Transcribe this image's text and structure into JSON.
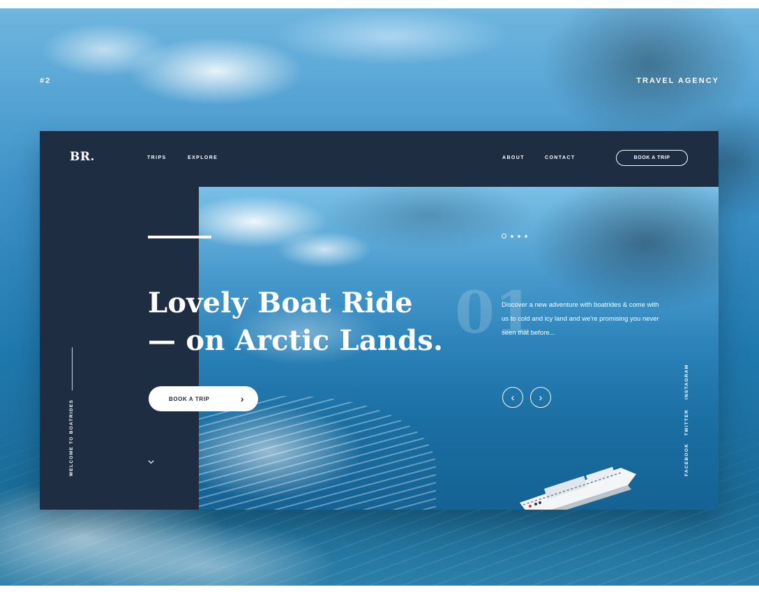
{
  "corner": {
    "left": "#2",
    "right": "TRAVEL AGENCY"
  },
  "nav": {
    "logo": "BR.",
    "links": [
      "TRIPS",
      "EXPLORE",
      "ABOUT",
      "CONTACT"
    ],
    "cta": "BOOK A TRIP"
  },
  "hero": {
    "headline_line1": "Lovely Boat Ride",
    "headline_line2": "— on Arctic Lands.",
    "cta": "BOOK A TRIP",
    "slide_number": "01",
    "description": "Discover a new adventure with boatrides & come with us to cold and icy land and we're promising you never seen that before...",
    "slides_total": 4,
    "active_slide": 1
  },
  "side_label": "WELCOME TO BOATRIDES",
  "social": [
    "FACEBOOK",
    "TWITTER",
    "INSTAGRAM"
  ],
  "icons": {
    "prev": "chevron-left-icon",
    "next": "chevron-right-icon",
    "cta_arrow": "chevron-right-icon",
    "scroll": "chevron-down-icon"
  },
  "colors": {
    "card": "#1e2d42",
    "accent": "#ffffff"
  }
}
